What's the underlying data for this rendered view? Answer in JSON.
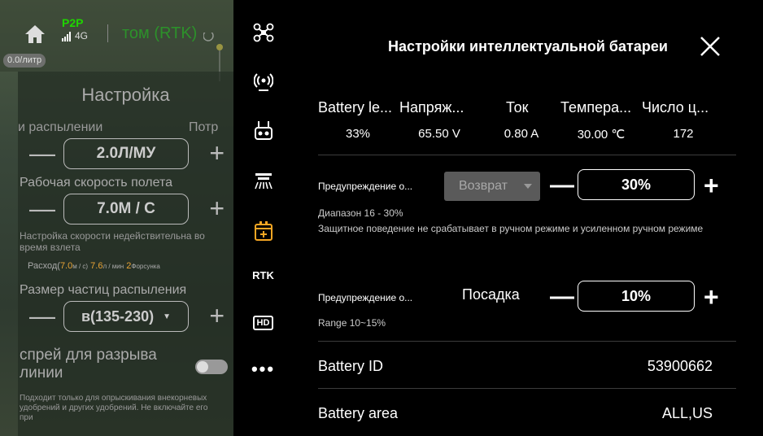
{
  "topbar": {
    "link_label": "P2P",
    "network": "4G",
    "mode": "том (RTK)",
    "speed_badge": "0.0/литр"
  },
  "spray_panel": {
    "title": "Настройка",
    "row1_left": "и распылении",
    "row1_right": "Потр",
    "dose_value": "2.0Л/МУ",
    "flight_speed_label": "Рабочая скорость полета",
    "flight_speed_value": "7.0М / С",
    "speed_note": "Настройка скорости недействительна во время взлета",
    "consumption": {
      "prefix": "Расход(",
      "speed": "7.0",
      "speed_unit": "м / с)",
      "flow": "7.6",
      "flow_unit": "л / мин",
      "nozzles": "2",
      "nozzles_unit": "Форсунка"
    },
    "particle_label": "Размер частиц распыления",
    "particle_value": "в(135-230)",
    "break_spray_label": "спрей для разрыва линии",
    "break_spray_note": "Подходит только для опрыскивания внекорневых удобрений и других удобрений. Не включайте его при"
  },
  "toolbar": {
    "items": [
      "drone-icon",
      "signal-icon",
      "remote-controller-icon",
      "spray-nozzle-icon",
      "battery-icon",
      "rtk",
      "hd-icon",
      "more-icon"
    ],
    "rtk_label": "RTK",
    "hd_label": "HD",
    "active_color": "#f5a623"
  },
  "battery_panel": {
    "title": "Настройки интеллектуальной батареи",
    "headers": [
      "Battery le...",
      "Напряж...",
      "Ток",
      "Темпера...",
      "Число ц..."
    ],
    "values": [
      "33%",
      "65.50 V",
      "0.80 A",
      "30.00 ℃",
      "172"
    ],
    "warning1": {
      "label": "Предупреждение о...",
      "action": "Возврат",
      "value": "30%",
      "range": "Диапазон 16 - 30%",
      "note": "Защитное поведение не срабатывает в ручном режиме и усиленном ручном режиме"
    },
    "warning2": {
      "label": "Предупреждение о...",
      "action": "Посадка",
      "value": "10%",
      "range": "Range 10~15%"
    },
    "battery_id_label": "Battery ID",
    "battery_id_value": "53900662",
    "battery_area_label": "Battery area",
    "battery_area_value": "ALL,US"
  }
}
